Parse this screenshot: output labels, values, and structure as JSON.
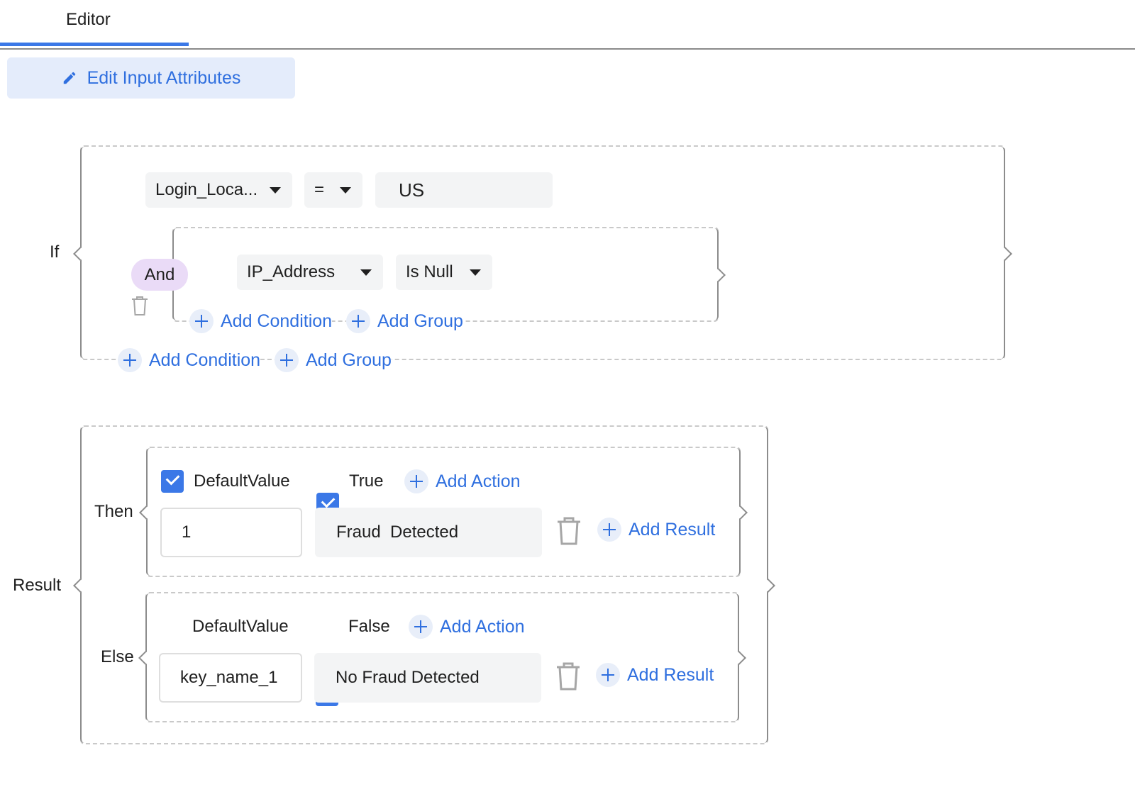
{
  "tabs": {
    "active_label": "Editor"
  },
  "toolbar": {
    "edit_label": "Edit Input Attributes",
    "edit_icon": "pencil-icon"
  },
  "accent_color": "#3b78e7",
  "condition": {
    "if_label": "If",
    "attribute": "Login_Loca...",
    "operator": "=",
    "value": "US",
    "group": {
      "logic": "And",
      "attribute": "IP_Address",
      "operator": "Is Null",
      "add_condition": "Add Condition",
      "add_group": "Add Group"
    },
    "add_condition": "Add Condition",
    "add_group": "Add Group"
  },
  "result": {
    "label": "Result",
    "then": {
      "label": "Then",
      "checkbox1_label": "DefaultValue",
      "checkbox2_label": "True",
      "add_action": "Add Action",
      "key_value": "1",
      "result_value": "Fraud  Detected",
      "add_result": "Add Result"
    },
    "else": {
      "label": "Else",
      "checkbox1_label": "DefaultValue",
      "checkbox2_label": "False",
      "add_action": "Add Action",
      "key_value": "key_name_1",
      "result_value": "No Fraud Detected",
      "add_result": "Add Result"
    }
  }
}
